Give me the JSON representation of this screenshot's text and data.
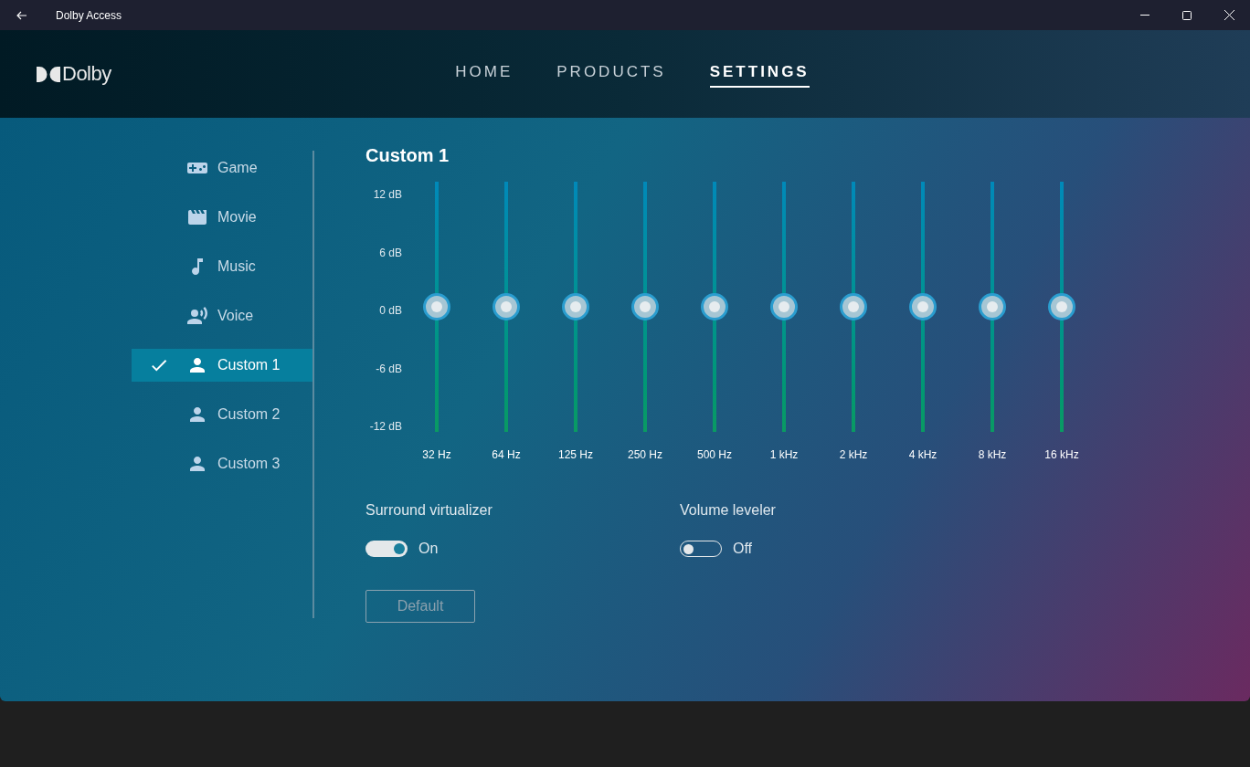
{
  "window": {
    "title": "Dolby Access"
  },
  "brand": {
    "name": "Dolby"
  },
  "nav": [
    {
      "label": "HOME",
      "selected": false
    },
    {
      "label": "PRODUCTS",
      "selected": false
    },
    {
      "label": "SETTINGS",
      "selected": true
    }
  ],
  "sidebar": {
    "items": [
      {
        "label": "Game",
        "selected": false
      },
      {
        "label": "Movie",
        "selected": false
      },
      {
        "label": "Music",
        "selected": false
      },
      {
        "label": "Voice",
        "selected": false
      },
      {
        "label": "Custom 1",
        "selected": true
      },
      {
        "label": "Custom 2",
        "selected": false
      },
      {
        "label": "Custom 3",
        "selected": false
      }
    ]
  },
  "equalizer": {
    "title": "Custom 1",
    "scale": [
      "12 dB",
      "6 dB",
      "0 dB",
      "-6 dB",
      "-12 dB"
    ],
    "bands": [
      {
        "label": "32 Hz",
        "level": 0.5
      },
      {
        "label": "64 Hz",
        "level": 0.5
      },
      {
        "label": "125 Hz",
        "level": 0.5
      },
      {
        "label": "250 Hz",
        "level": 0.5
      },
      {
        "label": "500 Hz",
        "level": 0.5
      },
      {
        "label": "1 kHz",
        "level": 0.5
      },
      {
        "label": "2 kHz",
        "level": 0.5
      },
      {
        "label": "4 kHz",
        "level": 0.5
      },
      {
        "label": "8 kHz",
        "level": 0.5
      },
      {
        "label": "16 kHz",
        "level": 0.5
      }
    ]
  },
  "toggles": [
    {
      "label": "Surround virtualizer",
      "on": true,
      "state_text": "On"
    },
    {
      "label": "Volume leveler",
      "on": false,
      "state_text": "Off"
    }
  ],
  "default_button": {
    "label": "Default",
    "disabled": true
  }
}
